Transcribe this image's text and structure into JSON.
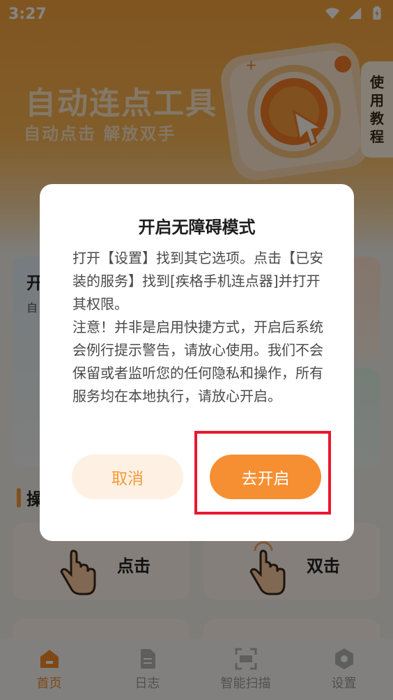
{
  "status_bar": {
    "time": "3:27"
  },
  "hero": {
    "title": "自动连点工具",
    "subtitle": "自动点击 解放双手"
  },
  "tutorial_tab": {
    "chars": [
      "使",
      "用",
      "教",
      "程"
    ]
  },
  "cards": {
    "left_title": "开",
    "left_sub": "自"
  },
  "section": {
    "title": "操"
  },
  "operations": [
    {
      "label": "点击",
      "icon": "single-finger-tap-icon"
    },
    {
      "label": "双击",
      "icon": "double-tap-icon"
    }
  ],
  "bottom_nav": [
    {
      "label": "首页",
      "icon": "home-icon",
      "active": true
    },
    {
      "label": "日志",
      "icon": "document-icon",
      "active": false
    },
    {
      "label": "智能扫描",
      "icon": "scan-icon",
      "active": false
    },
    {
      "label": "设置",
      "icon": "settings-hexagon-icon",
      "active": false
    }
  ],
  "dialog": {
    "title": "开启无障碍模式",
    "paragraph1": "打开【设置】找到其它选项。点击【已安装的服务】找到[疾格手机连点器]并打开其权限。",
    "paragraph2": "注意！并非是启用快捷方式，开启后系统会例行提示警告，请放心使用。我们不会保留或者监听您的任何隐私和操作，所有服务均在本地执行，请放心开启。",
    "cancel_label": "取消",
    "confirm_label": "去开启"
  },
  "colors": {
    "accent": "#f68f32",
    "highlight": "#e8182f",
    "hero_top": "#f6a33c"
  }
}
